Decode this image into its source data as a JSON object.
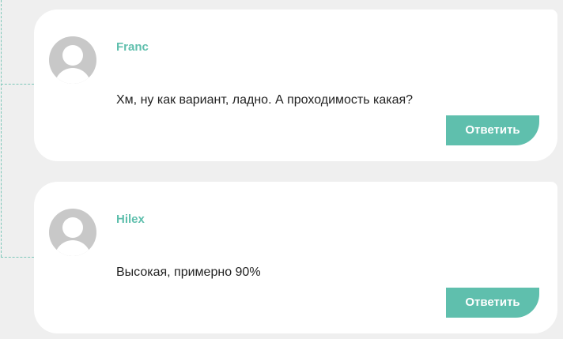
{
  "comments": [
    {
      "author": "Franc",
      "text": "Хм, ну как вариант, ладно. А проходимость какая?",
      "reply_label": "Ответить",
      "avatar_icon": "default-user-avatar-icon"
    },
    {
      "author": "Hilex",
      "text": "Высокая, примерно 90%",
      "reply_label": "Ответить",
      "avatar_icon": "default-user-avatar-icon"
    }
  ],
  "colors": {
    "accent": "#5fbfad",
    "background": "#efefef",
    "card": "#ffffff",
    "avatar": "#c8c8c8"
  }
}
